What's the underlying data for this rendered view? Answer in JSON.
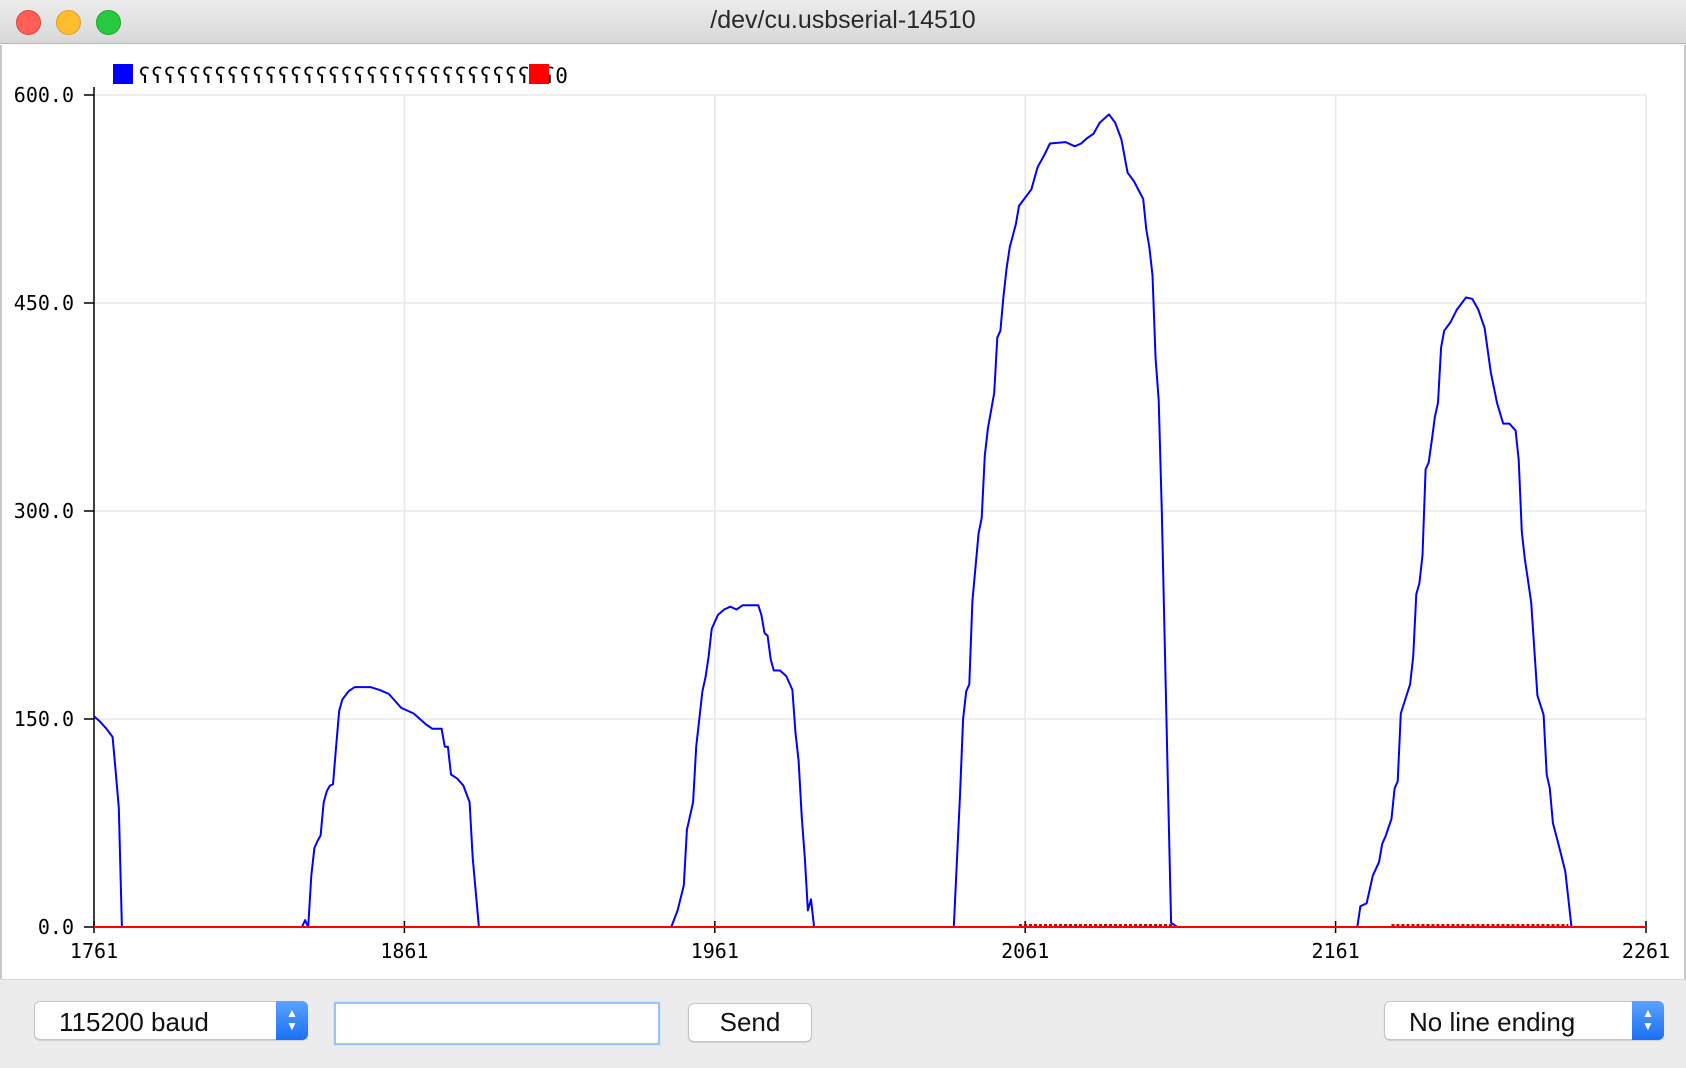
{
  "window": {
    "title": "/dev/cu.usbserial-14510"
  },
  "legend": {
    "label": "ʕʕʕʕʕʕʕʕʕʕʕʕʕʕʕʕʕʕʕʕʕʕʕʕʕʕʕʕʕʕʕʕʕ0"
  },
  "controls": {
    "baud": "115200 baud",
    "input_value": "",
    "send": "Send",
    "line_ending": "No line ending"
  },
  "chart_data": {
    "type": "line",
    "title": "",
    "xlabel": "",
    "ylabel": "",
    "xlim": [
      1761,
      2261
    ],
    "ylim": [
      0,
      600
    ],
    "x_ticks": [
      "1761",
      "1861",
      "1961",
      "2061",
      "2161",
      "2261"
    ],
    "y_ticks": [
      "0.0",
      "150.0",
      "300.0",
      "450.0",
      "600.0"
    ],
    "grid": true,
    "legend_position": "top-left",
    "series": [
      {
        "color": "#0000ff",
        "points": [
          [
            1761,
            152
          ],
          [
            1763,
            148
          ],
          [
            1765,
            143
          ],
          [
            1767,
            137
          ],
          [
            1768,
            112
          ],
          [
            1769,
            86
          ],
          [
            1770,
            0
          ],
          [
            1828,
            0
          ],
          [
            1829,
            5
          ],
          [
            1830,
            0
          ],
          [
            1831,
            37
          ],
          [
            1832,
            57
          ],
          [
            1833,
            62
          ],
          [
            1834,
            66
          ],
          [
            1835,
            90
          ],
          [
            1836,
            98
          ],
          [
            1837,
            102
          ],
          [
            1838,
            103
          ],
          [
            1839,
            130
          ],
          [
            1840,
            156
          ],
          [
            1841,
            164
          ],
          [
            1843,
            170
          ],
          [
            1845,
            173
          ],
          [
            1850,
            173
          ],
          [
            1853,
            171
          ],
          [
            1856,
            168
          ],
          [
            1858,
            163
          ],
          [
            1860,
            158
          ],
          [
            1864,
            154
          ],
          [
            1866,
            150
          ],
          [
            1868,
            146
          ],
          [
            1870,
            143
          ],
          [
            1873,
            143
          ],
          [
            1874,
            130
          ],
          [
            1875,
            130
          ],
          [
            1876,
            110
          ],
          [
            1878,
            107
          ],
          [
            1880,
            102
          ],
          [
            1881,
            96
          ],
          [
            1882,
            90
          ],
          [
            1883,
            50
          ],
          [
            1885,
            0
          ],
          [
            1947,
            0
          ],
          [
            1949,
            12
          ],
          [
            1951,
            30
          ],
          [
            1952,
            70
          ],
          [
            1954,
            90
          ],
          [
            1955,
            130
          ],
          [
            1957,
            170
          ],
          [
            1958,
            180
          ],
          [
            1959,
            195
          ],
          [
            1960,
            215
          ],
          [
            1962,
            225
          ],
          [
            1964,
            229
          ],
          [
            1966,
            231
          ],
          [
            1968,
            229
          ],
          [
            1970,
            232
          ],
          [
            1975,
            232
          ],
          [
            1976,
            225
          ],
          [
            1977,
            212
          ],
          [
            1978,
            210
          ],
          [
            1979,
            193
          ],
          [
            1980,
            185
          ],
          [
            1982,
            185
          ],
          [
            1984,
            181
          ],
          [
            1986,
            171
          ],
          [
            1987,
            140
          ],
          [
            1988,
            120
          ],
          [
            1989,
            80
          ],
          [
            1990,
            50
          ],
          [
            1991,
            12
          ],
          [
            1992,
            20
          ],
          [
            1993,
            0
          ],
          [
            2070,
            0
          ]
        ],
        "pts2": [
          [
            2038,
            0
          ],
          [
            2040,
            95
          ],
          [
            2041,
            150
          ],
          [
            2042,
            170
          ],
          [
            2043,
            175
          ],
          [
            2044,
            235
          ],
          [
            2046,
            284
          ],
          [
            2047,
            295
          ],
          [
            2048,
            340
          ],
          [
            2049,
            360
          ],
          [
            2051,
            385
          ],
          [
            2052,
            425
          ],
          [
            2053,
            430
          ],
          [
            2054,
            455
          ],
          [
            2055,
            475
          ],
          [
            2056,
            490
          ],
          [
            2058,
            507
          ],
          [
            2059,
            520
          ],
          [
            2061,
            526
          ],
          [
            2063,
            532
          ],
          [
            2065,
            548
          ],
          [
            2067,
            556
          ],
          [
            2069,
            565
          ],
          [
            2074,
            566
          ],
          [
            2077,
            563
          ],
          [
            2079,
            565
          ],
          [
            2081,
            569
          ],
          [
            2083,
            572
          ],
          [
            2085,
            580
          ],
          [
            2088,
            586
          ],
          [
            2090,
            580
          ],
          [
            2092,
            568
          ],
          [
            2094,
            544
          ],
          [
            2096,
            538
          ],
          [
            2099,
            525
          ],
          [
            2100,
            503
          ],
          [
            2101,
            490
          ],
          [
            2102,
            470
          ],
          [
            2103,
            410
          ],
          [
            2104,
            380
          ],
          [
            2105,
            300
          ],
          [
            2106,
            200
          ],
          [
            2107,
            100
          ],
          [
            2108,
            3
          ],
          [
            2110,
            0
          ],
          [
            2168,
            0
          ],
          [
            2169,
            15
          ],
          [
            2171,
            17
          ],
          [
            2172,
            27
          ],
          [
            2173,
            37
          ],
          [
            2175,
            47
          ],
          [
            2176,
            60
          ],
          [
            2177,
            65
          ],
          [
            2179,
            78
          ],
          [
            2180,
            100
          ],
          [
            2181,
            105
          ],
          [
            2182,
            154
          ],
          [
            2184,
            168
          ],
          [
            2185,
            175
          ],
          [
            2186,
            195
          ],
          [
            2187,
            240
          ],
          [
            2188,
            248
          ],
          [
            2189,
            268
          ],
          [
            2190,
            330
          ],
          [
            2191,
            335
          ],
          [
            2192,
            351
          ],
          [
            2193,
            368
          ],
          [
            2194,
            378
          ],
          [
            2195,
            418
          ],
          [
            2196,
            430
          ],
          [
            2198,
            436
          ],
          [
            2200,
            445
          ],
          [
            2203,
            454
          ],
          [
            2205,
            453
          ],
          [
            2207,
            445
          ],
          [
            2209,
            432
          ],
          [
            2211,
            400
          ],
          [
            2213,
            378
          ],
          [
            2215,
            363
          ],
          [
            2217,
            363
          ],
          [
            2219,
            358
          ],
          [
            2220,
            337
          ],
          [
            2221,
            285
          ],
          [
            2222,
            265
          ],
          [
            2223,
            250
          ],
          [
            2224,
            234
          ],
          [
            2226,
            167
          ],
          [
            2228,
            153
          ],
          [
            2229,
            110
          ],
          [
            2230,
            100
          ],
          [
            2231,
            75
          ],
          [
            2233,
            58
          ],
          [
            2235,
            40
          ],
          [
            2237,
            0
          ],
          [
            2261,
            0
          ]
        ]
      },
      {
        "color": "#ff0000",
        "points": [
          [
            1761,
            0
          ],
          [
            2261,
            0
          ]
        ]
      }
    ]
  }
}
